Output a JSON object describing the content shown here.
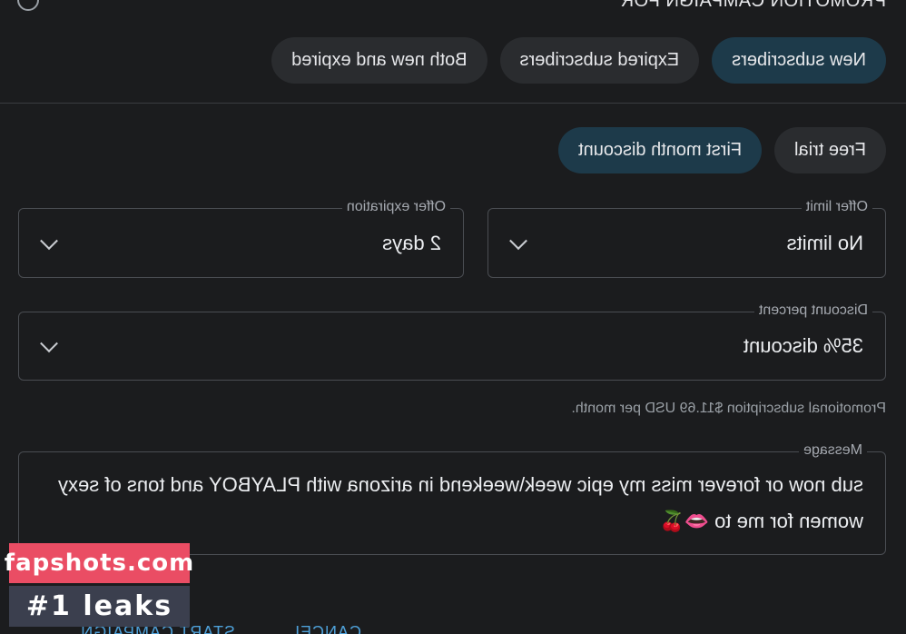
{
  "header": {
    "title": "PROMOTION CAMPAIGN FOR",
    "info_icon": "info-icon"
  },
  "audience": {
    "options": [
      "New subscribers",
      "Expired subscribers",
      "Both new and expired"
    ],
    "selected": "New subscribers"
  },
  "offer_type": {
    "options": [
      "Free trial",
      "First month discount"
    ],
    "selected": "First month discount"
  },
  "offer_limit": {
    "label": "Offer limit",
    "value": "No limits"
  },
  "offer_expiration": {
    "label": "Offer expiration",
    "value": "2 days"
  },
  "discount_percent": {
    "label": "Discount percent",
    "value": "35% discount"
  },
  "helper_text": "Promotional subscription $11.69 USD per month.",
  "message": {
    "label": "Message",
    "value": "sub now or forever miss my epic week\\weekend in arizona with PLAYBOY and tons of sexy women for me to 👄🍒"
  },
  "actions": {
    "cancel": "CANCEL",
    "start": "START CAMPAIGN"
  },
  "watermark": {
    "line1": "fapshots.com",
    "line2": "#1 leaks"
  },
  "colors": {
    "background": "#1b1c1e",
    "chip_active": "#1d3a4a",
    "chip": "#2a2c2f",
    "accent": "#4ea0d8"
  }
}
